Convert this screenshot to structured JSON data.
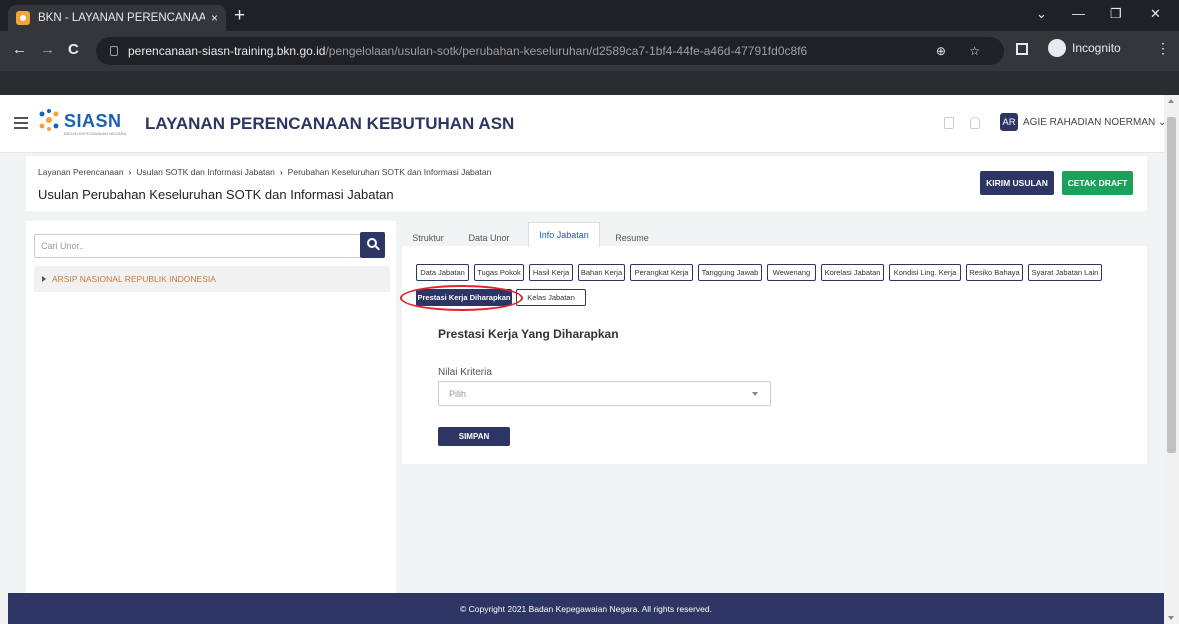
{
  "browser": {
    "tab_title": "BKN - LAYANAN PERENCANAAN",
    "tab_close": "×",
    "new_tab": "+",
    "url_host": "perencanaan-siasn-training.bkn.go.id",
    "url_path": "/pengelolaan/usulan-sotk/perubahan-keseluruhan/d2589ca7-1bf4-44fe-a46d-47791fd0c8f6",
    "incognito_label": "Incognito",
    "back": "←",
    "forward": "→",
    "reload": "C",
    "zoom_star": "⊕ ☆",
    "menu": "⋮",
    "win_chevron": "⌄",
    "win_min": "—",
    "win_restore": "❐",
    "win_close": "✕"
  },
  "header": {
    "logo_text": "SIASN",
    "logo_sub": "BADAN KEPEGAWAIAN NEGARA",
    "app_title": "LAYANAN PERENCANAAN KEBUTUHAN ASN",
    "avatar_initials": "AR",
    "user_name": "AGIE RAHADIAN NOERMAN ⌄"
  },
  "breadcrumb": {
    "items": [
      "Layanan Perencanaan",
      "Usulan SOTK dan Informasi Jabatan",
      "Perubahan Keseluruhan SOTK dan Informasi Jabatan"
    ],
    "separator": "›"
  },
  "page": {
    "title": "Usulan Perubahan Keseluruhan SOTK dan Informasi Jabatan",
    "kirim_label": "KIRIM USULAN",
    "cetak_label": "CETAK DRAFT"
  },
  "left": {
    "search_placeholder": "Cari Unor..",
    "tree_item": "ARSIP NASIONAL REPUBLIK INDONESIA"
  },
  "tabs": [
    "Struktur",
    "Data Unor",
    "Info Jabatan",
    "Resume"
  ],
  "chips_row1": [
    "Data Jabatan",
    "Tugas Pokok",
    "Hasil Kerja",
    "Bahan Kerja",
    "Perangkat Kerja",
    "Tanggung Jawab",
    "Wewenang",
    "Korelasi Jabatan",
    "Kondisi Ling. Kerja",
    "Resiko Bahaya",
    "Syarat Jabatan Lain"
  ],
  "chips_row2": [
    "Prestasi Kerja Diharapkan",
    "Kelas Jabatan"
  ],
  "form": {
    "section_title": "Prestasi Kerja Yang Diharapkan",
    "field_label": "Nilai Kriteria",
    "select_value": "Pilih",
    "save_label": "SIMPAN"
  },
  "footer": {
    "text": "© Copyright 2021 Badan Kepegawaian Negara. All rights reserved."
  },
  "colors": {
    "primary": "#2c3563",
    "green": "#1aa25c",
    "highlight_ring": "#e0242a"
  }
}
